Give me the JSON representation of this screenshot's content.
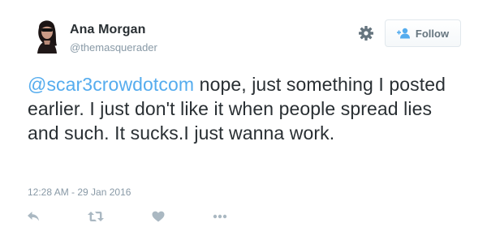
{
  "user": {
    "name": "Ana Morgan",
    "handle": "@themasquerader"
  },
  "header": {
    "follow_label": "Follow",
    "settings_icon": "gear-icon",
    "follow_icon": "follow-person-icon"
  },
  "tweet": {
    "mention": "@scar3crowdotcom",
    "body": " nope, just something I posted earlier. I just don't like it when people spread lies and such. It sucks.I just wanna work.",
    "timestamp": "12:28 AM - 29 Jan 2016"
  },
  "actions": {
    "icons": [
      "reply-icon",
      "retweet-icon",
      "like-icon",
      "more-icon"
    ]
  },
  "colors": {
    "mention": "#55acee",
    "muted": "#8899a6",
    "text": "#292f33",
    "follow_icon": "#55acee"
  }
}
